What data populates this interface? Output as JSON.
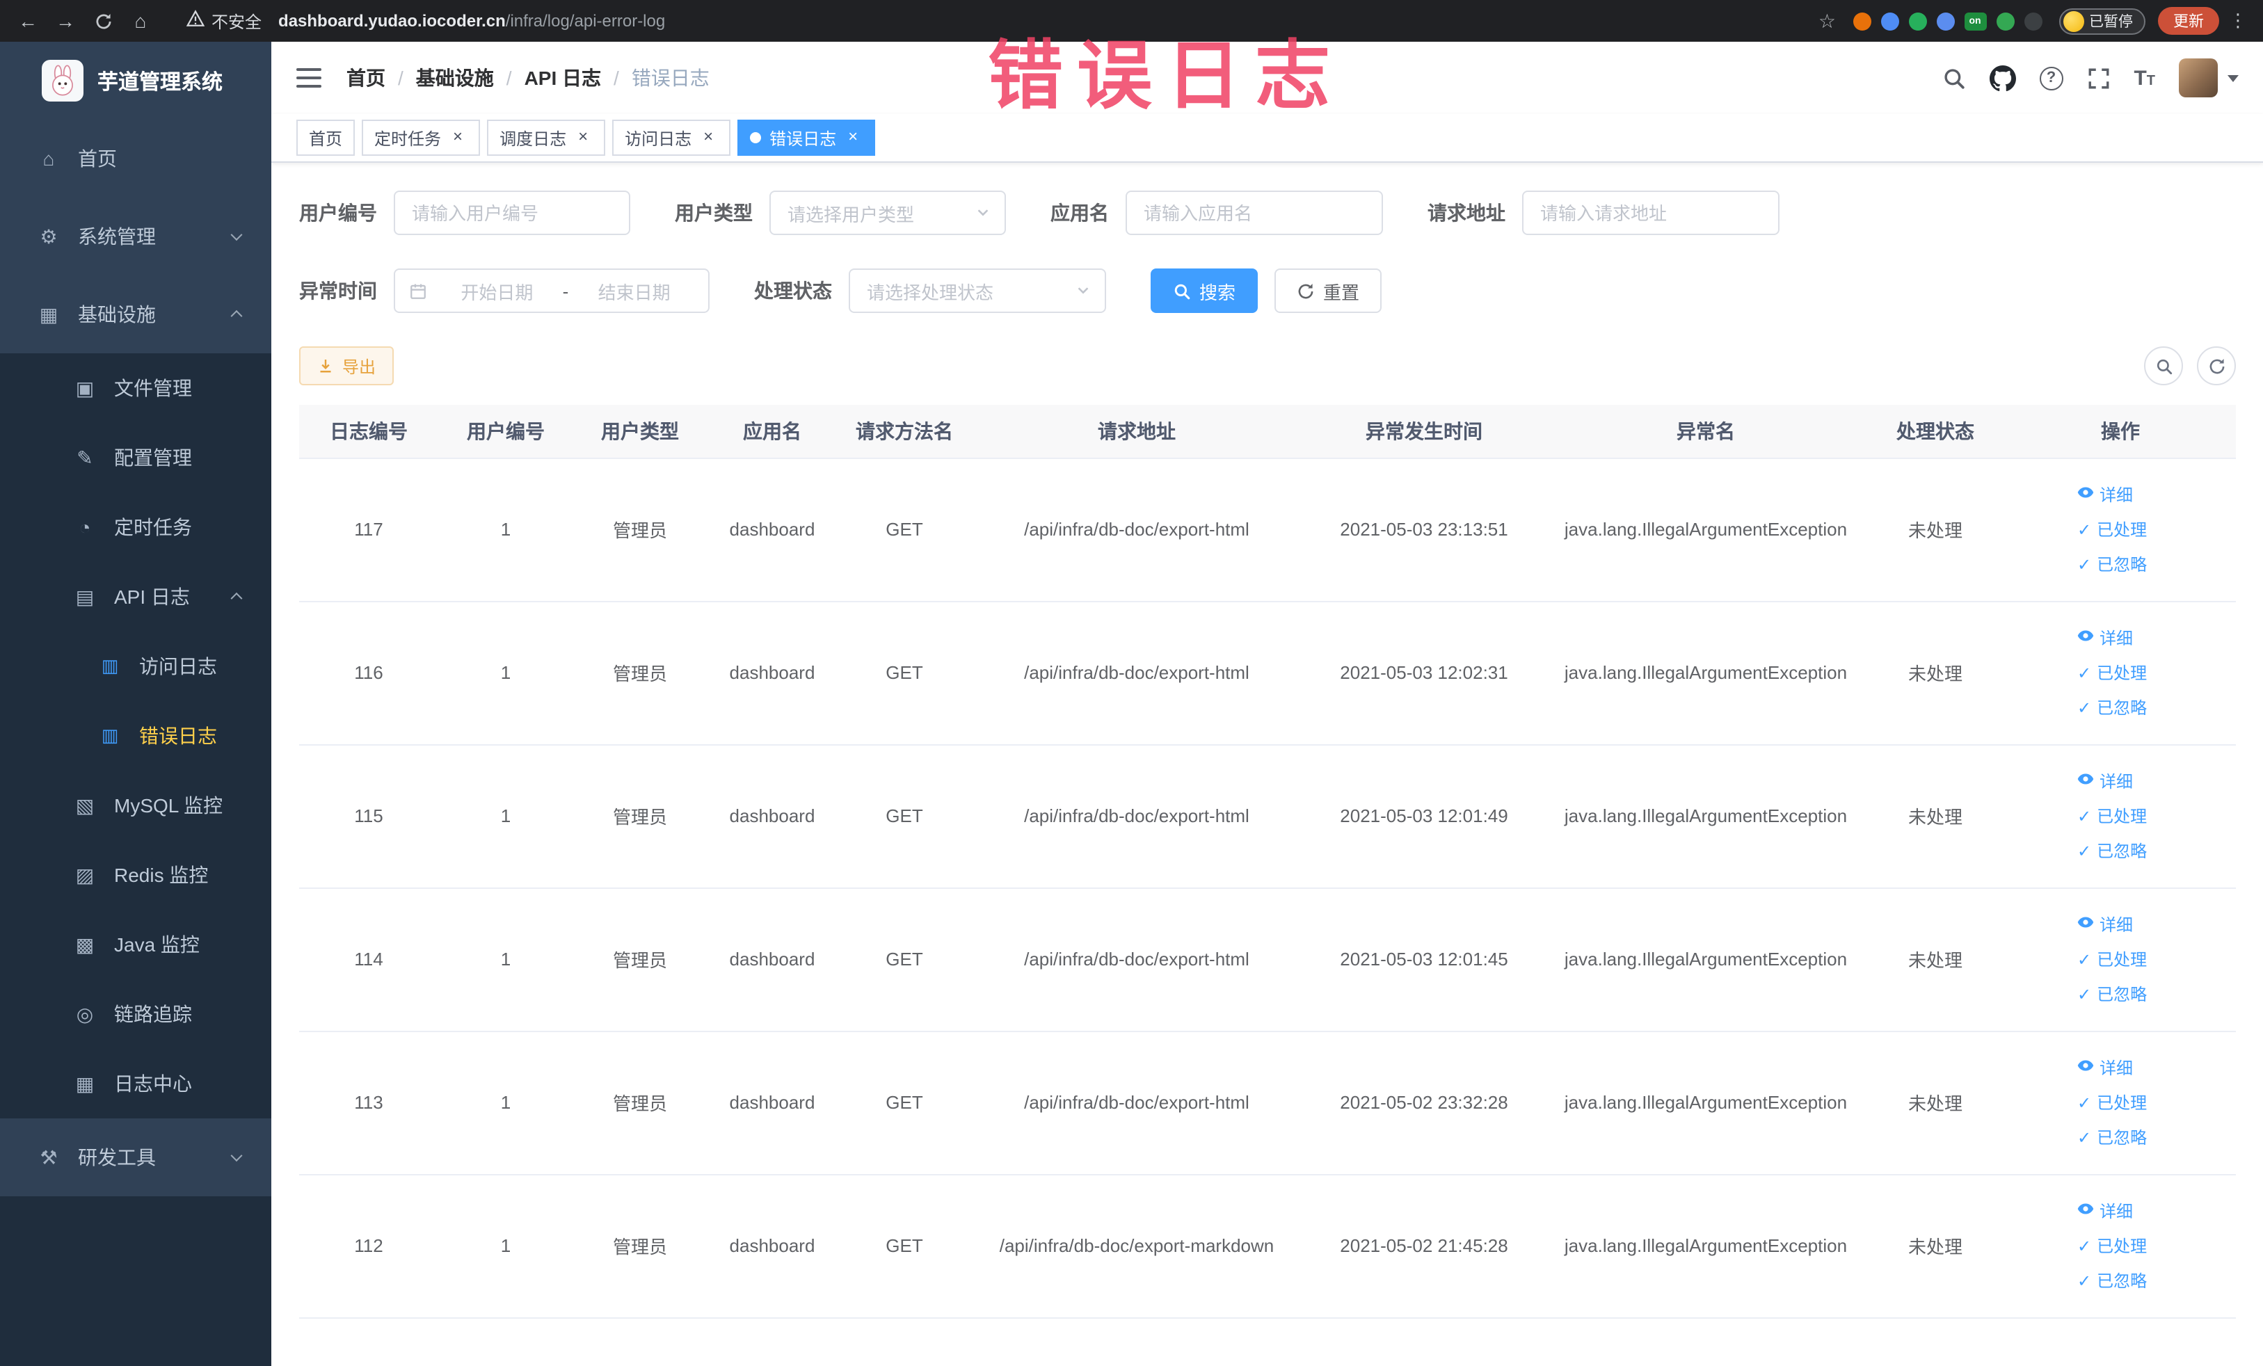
{
  "annotation": {
    "overlay_text": "错误日志",
    "color": "#f04164"
  },
  "browser": {
    "security_label": "不安全",
    "url_domain": "dashboard.yudao.iocoder.cn",
    "url_path": "/infra/log/api-error-log",
    "extensions": [
      {
        "key": "ext-orange-ball",
        "color": "#e8710a"
      },
      {
        "key": "ext-blue-drop",
        "color": "#4f8df5"
      },
      {
        "key": "ext-green-circle",
        "color": "#27b05c"
      },
      {
        "key": "ext-blue-grid",
        "color": "#5b8def"
      },
      {
        "key": "ext-on-badge",
        "color": "#1e8e3e",
        "text": "on"
      },
      {
        "key": "ext-green-leaf",
        "color": "#34a853"
      },
      {
        "key": "ext-dark-pin",
        "color": "#3c4043"
      }
    ],
    "profile_label": "已暂停",
    "update_label": "更新"
  },
  "sidebar": {
    "app_title": "芋道管理系统",
    "items": [
      {
        "key": "home",
        "label": "首页",
        "level": 1,
        "icon": "home"
      },
      {
        "key": "system",
        "label": "系统管理",
        "level": 1,
        "icon": "system",
        "arrow": "down"
      },
      {
        "key": "infra",
        "label": "基础设施",
        "level": 1,
        "icon": "infra",
        "arrow": "up"
      },
      {
        "key": "file",
        "label": "文件管理",
        "level": 2,
        "icon": "file"
      },
      {
        "key": "config",
        "label": "配置管理",
        "level": 2,
        "icon": "config"
      },
      {
        "key": "job",
        "label": "定时任务",
        "level": 2,
        "icon": "timer"
      },
      {
        "key": "api-log",
        "label": "API 日志",
        "level": 2,
        "icon": "api-log",
        "arrow": "up"
      },
      {
        "key": "access-log",
        "label": "访问日志",
        "level": 3,
        "icon": "doc"
      },
      {
        "key": "error-log",
        "label": "错误日志",
        "level": 3,
        "icon": "doc",
        "active": true
      },
      {
        "key": "mysql",
        "label": "MySQL 监控",
        "level": 2,
        "icon": "mysql"
      },
      {
        "key": "redis",
        "label": "Redis 监控",
        "level": 2,
        "icon": "redis"
      },
      {
        "key": "java",
        "label": "Java 监控",
        "level": 2,
        "icon": "java"
      },
      {
        "key": "trace",
        "label": "链路追踪",
        "level": 2,
        "icon": "trace"
      },
      {
        "key": "log-center",
        "label": "日志中心",
        "level": 2,
        "icon": "log-center"
      },
      {
        "key": "dev-tools",
        "label": "研发工具",
        "level": 1,
        "icon": "tools",
        "arrow": "down"
      }
    ]
  },
  "navbar": {
    "breadcrumbs": [
      "首页",
      "基础设施",
      "API 日志",
      "错误日志"
    ],
    "breadcrumb_separator": "/"
  },
  "tags_view": [
    {
      "key": "home",
      "label": "首页",
      "closable": false
    },
    {
      "key": "job",
      "label": "定时任务",
      "closable": true
    },
    {
      "key": "job-log",
      "label": "调度日志",
      "closable": true
    },
    {
      "key": "access-log",
      "label": "访问日志",
      "closable": true
    },
    {
      "key": "error-log",
      "label": "错误日志",
      "closable": true,
      "active": true
    }
  ],
  "filters": {
    "user_id": {
      "label": "用户编号",
      "placeholder": "请输入用户编号"
    },
    "user_type": {
      "label": "用户类型",
      "placeholder": "请选择用户类型"
    },
    "app_name": {
      "label": "应用名",
      "placeholder": "请输入应用名"
    },
    "request_url": {
      "label": "请求地址",
      "placeholder": "请输入请求地址"
    },
    "exception_time": {
      "label": "异常时间",
      "start_placeholder": "开始日期",
      "separator": "-",
      "end_placeholder": "结束日期"
    },
    "process_status": {
      "label": "处理状态",
      "placeholder": "请选择处理状态"
    },
    "search_label": "搜索",
    "reset_label": "重置"
  },
  "toolbar": {
    "export_label": "导出"
  },
  "table": {
    "columns": [
      "日志编号",
      "用户编号",
      "用户类型",
      "应用名",
      "请求方法名",
      "请求地址",
      "异常发生时间",
      "异常名",
      "处理状态",
      "操作"
    ],
    "column_keys": [
      "log-id",
      "user-id",
      "user-type",
      "app-name",
      "method",
      "request-url",
      "error-time",
      "exception-name",
      "status",
      "actions"
    ],
    "field_order": [
      "id",
      "user_id",
      "user_type",
      "app",
      "method",
      "url",
      "time",
      "exception",
      "status"
    ],
    "rows": [
      {
        "id": "117",
        "user_id": "1",
        "user_type": "管理员",
        "app": "dashboard",
        "method": "GET",
        "url": "/api/infra/db-doc/export-html",
        "time": "2021-05-03 23:13:51",
        "exception": "java.lang.IllegalArgumentException",
        "status": "未处理"
      },
      {
        "id": "116",
        "user_id": "1",
        "user_type": "管理员",
        "app": "dashboard",
        "method": "GET",
        "url": "/api/infra/db-doc/export-html",
        "time": "2021-05-03 12:02:31",
        "exception": "java.lang.IllegalArgumentException",
        "status": "未处理"
      },
      {
        "id": "115",
        "user_id": "1",
        "user_type": "管理员",
        "app": "dashboard",
        "method": "GET",
        "url": "/api/infra/db-doc/export-html",
        "time": "2021-05-03 12:01:49",
        "exception": "java.lang.IllegalArgumentException",
        "status": "未处理"
      },
      {
        "id": "114",
        "user_id": "1",
        "user_type": "管理员",
        "app": "dashboard",
        "method": "GET",
        "url": "/api/infra/db-doc/export-html",
        "time": "2021-05-03 12:01:45",
        "exception": "java.lang.IllegalArgumentException",
        "status": "未处理"
      },
      {
        "id": "113",
        "user_id": "1",
        "user_type": "管理员",
        "app": "dashboard",
        "method": "GET",
        "url": "/api/infra/db-doc/export-html",
        "time": "2021-05-02 23:32:28",
        "exception": "java.lang.IllegalArgumentException",
        "status": "未处理"
      },
      {
        "id": "112",
        "user_id": "1",
        "user_type": "管理员",
        "app": "dashboard",
        "method": "GET",
        "url": "/api/infra/db-doc/export-markdown",
        "time": "2021-05-02 21:45:28",
        "exception": "java.lang.IllegalArgumentException",
        "status": "未处理"
      }
    ],
    "row_actions": [
      {
        "key": "detail",
        "label": "详细",
        "icon": "eye"
      },
      {
        "key": "processed",
        "label": "已处理",
        "icon": "check"
      },
      {
        "key": "ignored",
        "label": "已忽略",
        "icon": "check"
      }
    ]
  },
  "colors": {
    "primary": "#409eff",
    "sidebar_bg": "#304156",
    "submenu_bg": "#1f2d3d",
    "active_menu_text": "#ffd04b",
    "warning_button_text": "#e6a23c",
    "annotation": "#f04164"
  }
}
